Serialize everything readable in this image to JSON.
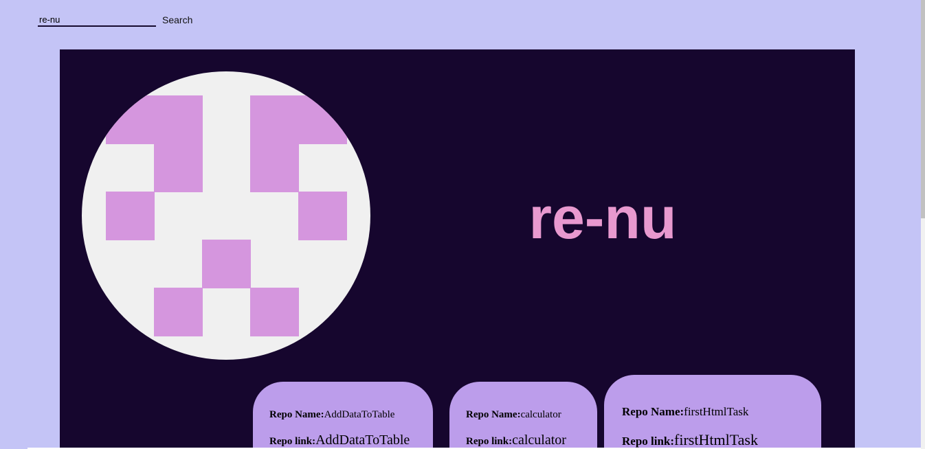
{
  "search": {
    "value": "re-nu",
    "button_label": "Search"
  },
  "profile": {
    "username": "re-nu",
    "avatar_icon": "identicon-avatar",
    "avatar_colors": {
      "background": "#f0f0f0",
      "pattern": "#d596de"
    }
  },
  "repos": [
    {
      "name_label": "Repo Name:",
      "name": "AddDataToTable",
      "link_label": "Repo link:",
      "link": "AddDataToTable"
    },
    {
      "name_label": "Repo Name:",
      "name": "calculator",
      "link_label": "Repo link:",
      "link": "calculator"
    },
    {
      "name_label": "Repo Name:",
      "name": "firstHtmlTask",
      "link_label": "Repo link:",
      "link": "firstHtmlTask"
    }
  ],
  "colors": {
    "page_background": "#c4c4f6",
    "panel_background": "#16062e",
    "username_color": "#e899cf",
    "card_background": "#bc9deb"
  }
}
